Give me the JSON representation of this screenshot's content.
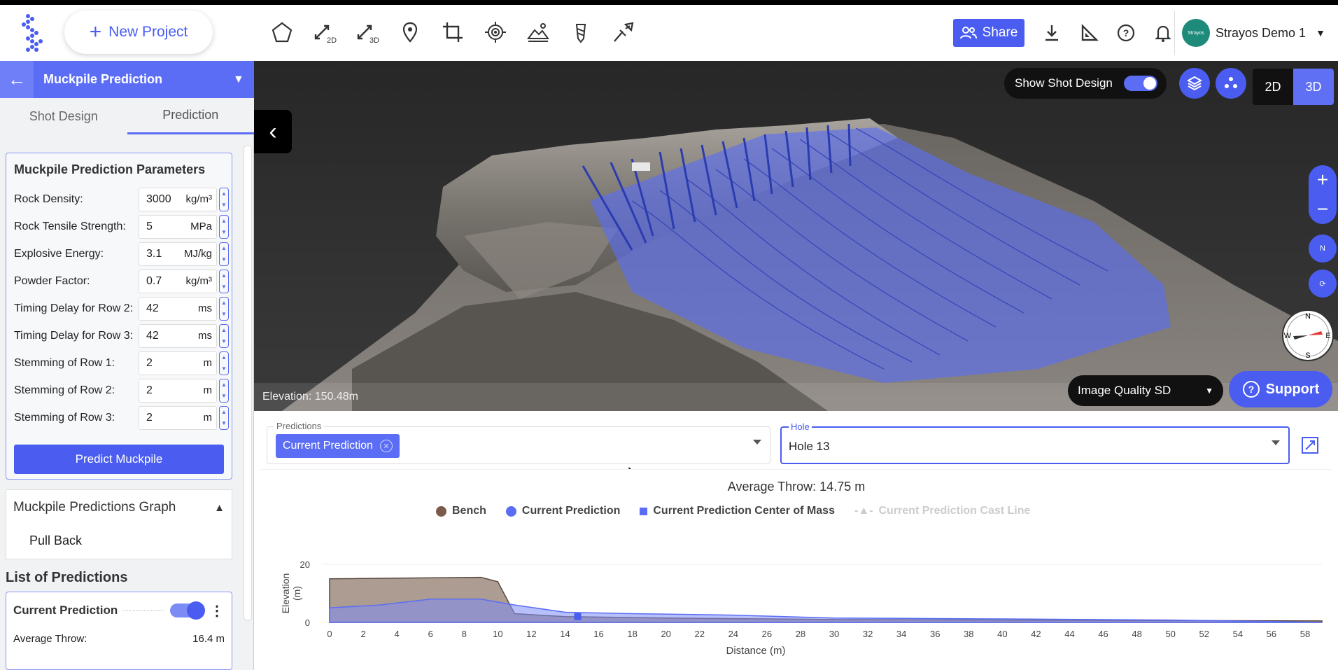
{
  "topbar": {
    "new_project": "New Project",
    "share": "Share",
    "user_name": "Strayos Demo 1",
    "avatar_text": "Strayos"
  },
  "sidebar": {
    "header_title": "Muckpile Prediction",
    "tabs": [
      "Shot Design",
      "Prediction"
    ],
    "params_title": "Muckpile Prediction Parameters",
    "params": [
      {
        "label": "Rock Density:",
        "value": "3000",
        "unit": "kg/m³"
      },
      {
        "label": "Rock Tensile Strength:",
        "value": "5",
        "unit": "MPa"
      },
      {
        "label": "Explosive Energy:",
        "value": "3.1",
        "unit": "MJ/kg"
      },
      {
        "label": "Powder Factor:",
        "value": "0.7",
        "unit": "kg/m³"
      },
      {
        "label": "Timing Delay for Row 2:",
        "value": "42",
        "unit": "ms"
      },
      {
        "label": "Timing Delay for Row 3:",
        "value": "42",
        "unit": "ms"
      },
      {
        "label": "Stemming of Row 1:",
        "value": "2",
        "unit": "m"
      },
      {
        "label": "Stemming of Row 2:",
        "value": "2",
        "unit": "m"
      },
      {
        "label": "Stemming of Row 3:",
        "value": "2",
        "unit": "m"
      }
    ],
    "predict_button": "Predict Muckpile",
    "graph_title": "Muckpile Predictions Graph",
    "pull_back": "Pull Back",
    "list_title": "List of Predictions",
    "prediction_name": "Current Prediction",
    "avg_throw_label": "Average Throw:",
    "avg_throw_value": "16.4 m"
  },
  "viewport": {
    "show_shot_design": "Show Shot Design",
    "mode_2d": "2D",
    "mode_3d": "3D",
    "elevation": "Elevation: 150.48m",
    "image_quality": "Image Quality SD",
    "support": "Support",
    "compass": {
      "n": "N",
      "s": "S",
      "e": "E",
      "w": "W"
    },
    "rot_label": "N"
  },
  "bottom": {
    "predictions_label": "Predictions",
    "predictions_chip": "Current Prediction",
    "hole_label": "Hole",
    "hole_value": "Hole 13"
  },
  "colors": {
    "accent": "#4a5df0",
    "bench": "#7a5a4a",
    "prediction": "#5b6df5"
  },
  "chart_data": {
    "type": "area",
    "title": "Average Throw: 14.75 m",
    "xlabel": "Distance (m)",
    "ylabel": "Elevation (m)",
    "xlim": [
      0,
      59
    ],
    "ylim": [
      0,
      20
    ],
    "x_ticks": [
      0,
      2,
      4,
      6,
      8,
      10,
      12,
      14,
      16,
      18,
      20,
      22,
      24,
      26,
      28,
      30,
      32,
      34,
      36,
      38,
      40,
      42,
      44,
      46,
      48,
      50,
      52,
      54,
      56,
      58
    ],
    "y_ticks": [
      0,
      20
    ],
    "legend": [
      "Bench",
      "Current Prediction",
      "Current Prediction Center of Mass",
      "Current Prediction Cast Line"
    ],
    "series": [
      {
        "name": "Bench",
        "x": [
          0,
          0,
          9,
          10,
          11,
          14,
          20,
          30,
          59
        ],
        "y": [
          0,
          15,
          15.5,
          14,
          3,
          2,
          1.5,
          1,
          0.5
        ]
      },
      {
        "name": "Current Prediction",
        "x": [
          0,
          0,
          3,
          6,
          9,
          10,
          11,
          14,
          18,
          24,
          30,
          40,
          50,
          56,
          59
        ],
        "y": [
          0,
          5,
          6,
          8,
          8,
          7,
          6,
          3.5,
          3,
          2.5,
          1.5,
          1.2,
          0.8,
          0.3,
          0
        ]
      },
      {
        "name": "Current Prediction Center of Mass",
        "x": [
          14.75
        ],
        "y": [
          2
        ]
      }
    ]
  }
}
